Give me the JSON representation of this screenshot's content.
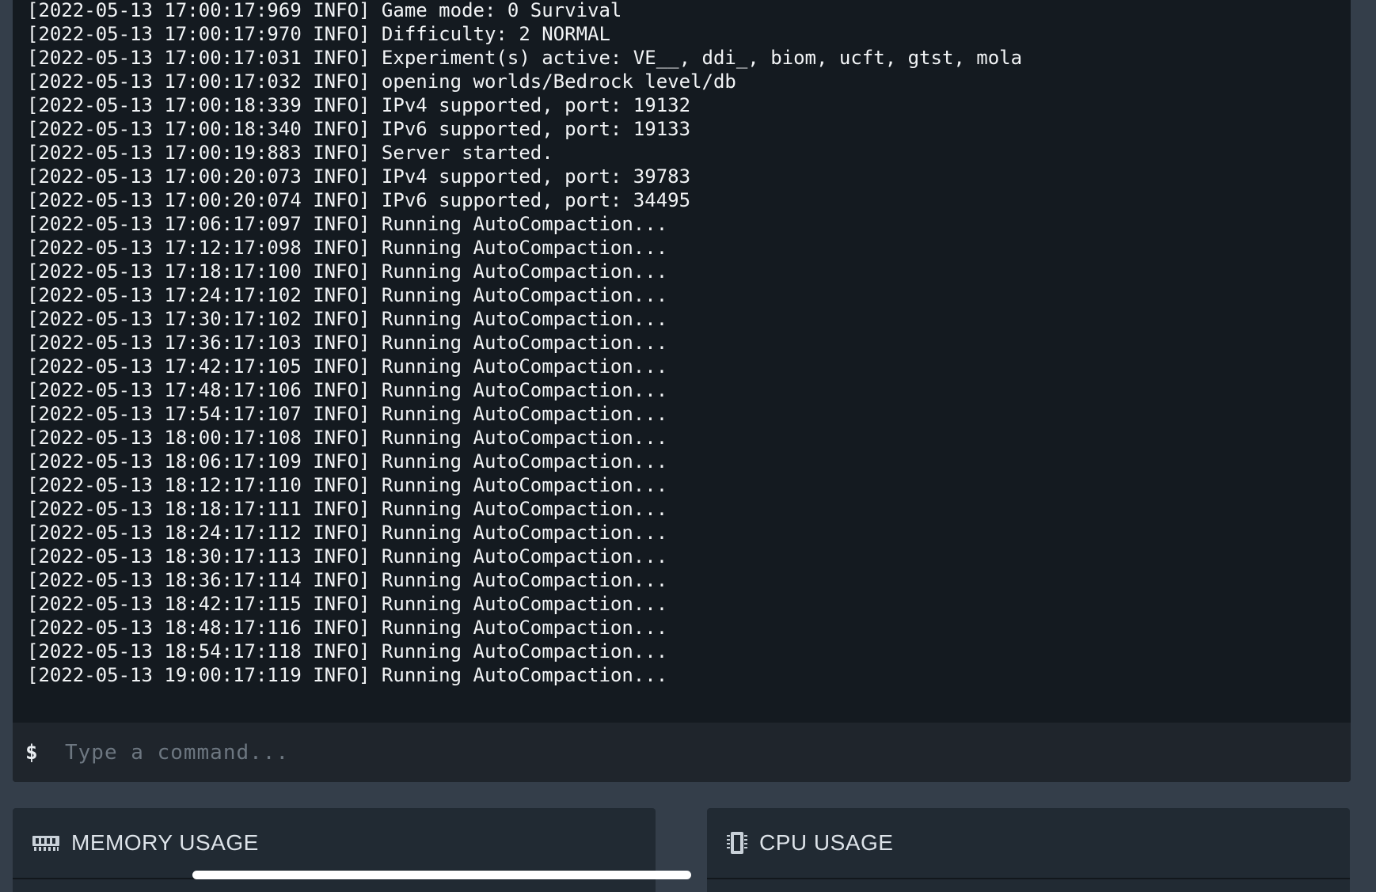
{
  "console": {
    "lines": [
      "[2022-05-13 17:00:17:969 INFO] Game mode: 0 Survival",
      "[2022-05-13 17:00:17:970 INFO] Difficulty: 2 NORMAL",
      "[2022-05-13 17:00:17:031 INFO] Experiment(s) active: VE__, ddi_, biom, ucft, gtst, mola",
      "[2022-05-13 17:00:17:032 INFO] opening worlds/Bedrock level/db",
      "[2022-05-13 17:00:18:339 INFO] IPv4 supported, port: 19132",
      "[2022-05-13 17:00:18:340 INFO] IPv6 supported, port: 19133",
      "[2022-05-13 17:00:19:883 INFO] Server started.",
      "[2022-05-13 17:00:20:073 INFO] IPv4 supported, port: 39783",
      "[2022-05-13 17:00:20:074 INFO] IPv6 supported, port: 34495",
      "[2022-05-13 17:06:17:097 INFO] Running AutoCompaction...",
      "[2022-05-13 17:12:17:098 INFO] Running AutoCompaction...",
      "[2022-05-13 17:18:17:100 INFO] Running AutoCompaction...",
      "[2022-05-13 17:24:17:102 INFO] Running AutoCompaction...",
      "[2022-05-13 17:30:17:102 INFO] Running AutoCompaction...",
      "[2022-05-13 17:36:17:103 INFO] Running AutoCompaction...",
      "[2022-05-13 17:42:17:105 INFO] Running AutoCompaction...",
      "[2022-05-13 17:48:17:106 INFO] Running AutoCompaction...",
      "[2022-05-13 17:54:17:107 INFO] Running AutoCompaction...",
      "[2022-05-13 18:00:17:108 INFO] Running AutoCompaction...",
      "[2022-05-13 18:06:17:109 INFO] Running AutoCompaction...",
      "[2022-05-13 18:12:17:110 INFO] Running AutoCompaction...",
      "[2022-05-13 18:18:17:111 INFO] Running AutoCompaction...",
      "[2022-05-13 18:24:17:112 INFO] Running AutoCompaction...",
      "[2022-05-13 18:30:17:113 INFO] Running AutoCompaction...",
      "[2022-05-13 18:36:17:114 INFO] Running AutoCompaction...",
      "[2022-05-13 18:42:17:115 INFO] Running AutoCompaction...",
      "[2022-05-13 18:48:17:116 INFO] Running AutoCompaction...",
      "[2022-05-13 18:54:17:118 INFO] Running AutoCompaction...",
      "[2022-05-13 19:00:17:119 INFO] Running AutoCompaction..."
    ],
    "prompt_symbol": "$",
    "command_placeholder": "Type a command...",
    "command_value": ""
  },
  "cards": {
    "memory": {
      "title": "MEMORY USAGE",
      "icon": "memory-icon"
    },
    "cpu": {
      "title": "CPU USAGE",
      "icon": "cpu-icon"
    }
  },
  "colors": {
    "page_background": "#343e4a",
    "console_background": "#141a20",
    "card_background": "#212a33",
    "console_text": "#f2f4f6"
  }
}
